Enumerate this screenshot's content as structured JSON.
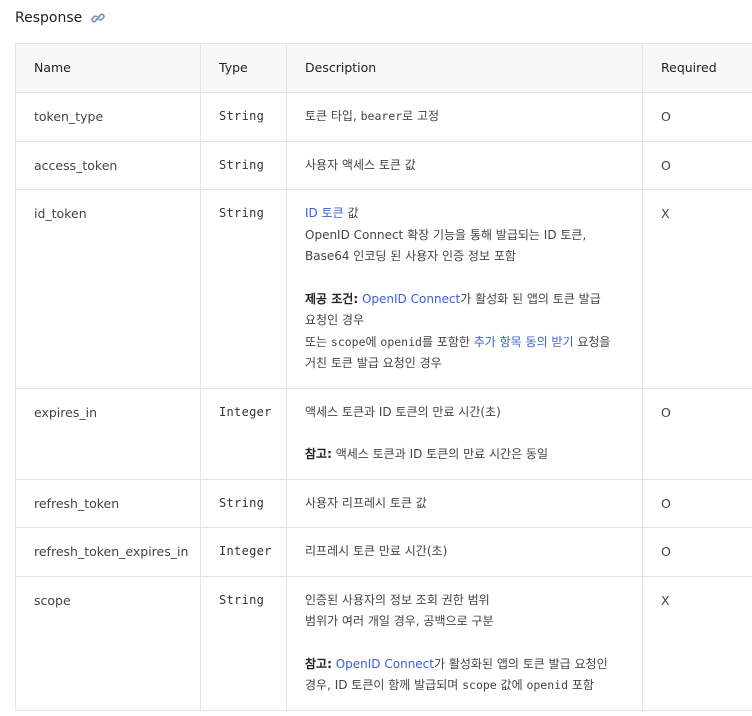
{
  "section": {
    "title": "Response",
    "icon": "link-icon"
  },
  "table": {
    "headers": {
      "name": "Name",
      "type": "Type",
      "description": "Description",
      "required": "Required"
    },
    "rows": [
      {
        "name": "token_type",
        "type": "String",
        "desc": {
          "l1a": "토큰 타입, ",
          "l1code": "bearer",
          "l1b": "로 고정"
        },
        "required": "O"
      },
      {
        "name": "access_token",
        "type": "String",
        "desc": {
          "l1": "사용자 액세스 토큰 값"
        },
        "required": "O"
      },
      {
        "name": "id_token",
        "type": "String",
        "desc": {
          "l1link": "ID 토큰",
          "l1b": " 값",
          "l2": "OpenID Connect 확장 기능을 통해 발급되는 ID 토큰,",
          "l3": "Base64 인코딩 된 사용자 인증 정보 포함",
          "cond_label": "제공 조건:",
          "cond_link": "OpenID Connect",
          "cond_rest": "가 활성화 된 앱의 토큰 발급",
          "cond_l2": "요청인 경우",
          "or_a": "또는 ",
          "or_code1": "scope",
          "or_b": "에 ",
          "or_code2": "openid",
          "or_c": "를 포함한 ",
          "or_link": "추가 항목 동의 받기",
          "or_d": " 요청을",
          "or_l2": "거친 토큰 발급 요청인 경우"
        },
        "required": "X"
      },
      {
        "name": "expires_in",
        "type": "Integer",
        "desc": {
          "l1": "액세스 토큰과 ID 토큰의 만료 시간(초)",
          "note_label": "참고:",
          "note_text": " 액세스 토큰과 ID 토큰의 만료 시간은 동일"
        },
        "required": "O"
      },
      {
        "name": "refresh_token",
        "type": "String",
        "desc": {
          "l1": "사용자 리프레시 토큰 값"
        },
        "required": "O"
      },
      {
        "name": "refresh_token_expires_in",
        "type": "Integer",
        "desc": {
          "l1": "리프레시 토큰 만료 시간(초)"
        },
        "required": "O"
      },
      {
        "name": "scope",
        "type": "String",
        "desc": {
          "l1": "인증된 사용자의 정보 조회 권한 범위",
          "l2": "범위가 여러 개일 경우, 공백으로 구분",
          "note_label": "참고:",
          "note_link": "OpenID Connect",
          "note_rest": "가 활성화된 앱의 토큰 발급 요청인",
          "note_l2a": "경우, ID 토큰이 함께 발급되며 ",
          "note_code1": "scope",
          "note_l2b": " 값에 ",
          "note_code2": "openid",
          "note_l2c": " 포함"
        },
        "required": "X"
      }
    ]
  },
  "colors": {
    "link": "#3a5fd9",
    "header_bg": "#f7f7f8",
    "border": "#e4e4e4"
  }
}
